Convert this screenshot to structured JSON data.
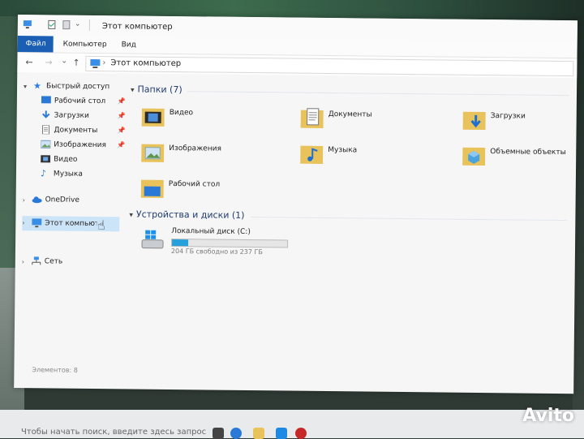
{
  "window": {
    "title": "Этот компьютер"
  },
  "ribbon": {
    "tabs": [
      "Файл",
      "Компьютер",
      "Вид"
    ]
  },
  "address": {
    "crumb": "Этот компьютер",
    "sep": "›"
  },
  "nav": {
    "back": "←",
    "forward": "→",
    "dropdown": "⌄",
    "up": "↑",
    "quick_access": "Быстрый доступ",
    "quick_items": [
      {
        "label": "Рабочий стол",
        "pinned": true
      },
      {
        "label": "Загрузки",
        "pinned": true
      },
      {
        "label": "Документы",
        "pinned": true
      },
      {
        "label": "Изображения",
        "pinned": true
      },
      {
        "label": "Видео",
        "pinned": false
      },
      {
        "label": "Музыка",
        "pinned": false
      }
    ],
    "onedrive": "OneDrive",
    "this_pc": "Этот компьютер",
    "network": "Сеть",
    "pin_glyph": "📌"
  },
  "main": {
    "folders_header": "Папки (7)",
    "folders": [
      {
        "label": "Видео",
        "icon": "video-folder-icon"
      },
      {
        "label": "Документы",
        "icon": "documents-folder-icon"
      },
      {
        "label": "Загрузки",
        "icon": "downloads-folder-icon"
      },
      {
        "label": "Изображения",
        "icon": "pictures-folder-icon"
      },
      {
        "label": "Музыка",
        "icon": "music-folder-icon"
      },
      {
        "label": "Объемные объекты",
        "icon": "3d-objects-folder-icon"
      },
      {
        "label": "Рабочий стол",
        "icon": "desktop-folder-icon"
      }
    ],
    "devices_header": "Устройства и диски (1)",
    "drive": {
      "label": "Локальный диск (C:)",
      "free_text": "204 ГБ свободно из 237 ГБ",
      "used_fraction": 0.14
    }
  },
  "status": {
    "items": "Элементов: 8"
  },
  "taskbar": {
    "search": "Чтобы начать поиск, введите здесь запрос"
  },
  "watermark": "Avito",
  "colors": {
    "accent": "#1a5fb4",
    "selection": "#cce4f7",
    "drive_fill": "#26a0da",
    "folder": "#e8c25a"
  }
}
